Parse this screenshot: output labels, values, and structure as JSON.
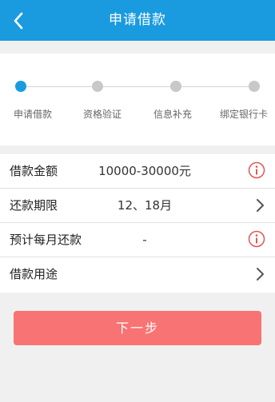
{
  "header": {
    "title": "申请借款",
    "back_icon": "chevron-left-icon",
    "background": "#1a9be0"
  },
  "steps": [
    {
      "label": "申请借款",
      "active": true
    },
    {
      "label": "资格验证",
      "active": false
    },
    {
      "label": "信息补充",
      "active": false
    },
    {
      "label": "绑定银行卡",
      "active": false
    }
  ],
  "form": {
    "rows": [
      {
        "label": "借款金额",
        "value": "10000-30000元",
        "icon": "info-icon"
      },
      {
        "label": "还款期限",
        "value": "12、18月",
        "icon": "chevron-right-icon"
      },
      {
        "label": "预计每月还款",
        "value": "-",
        "icon": "info-icon"
      },
      {
        "label": "借款用途",
        "value": "",
        "icon": "chevron-right-icon"
      }
    ]
  },
  "actions": {
    "next_label": "下一步",
    "next_color": "#f87373"
  },
  "colors": {
    "accent": "#1a9be0",
    "step_inactive": "#c8c8c8",
    "info_icon": "#e25555"
  }
}
